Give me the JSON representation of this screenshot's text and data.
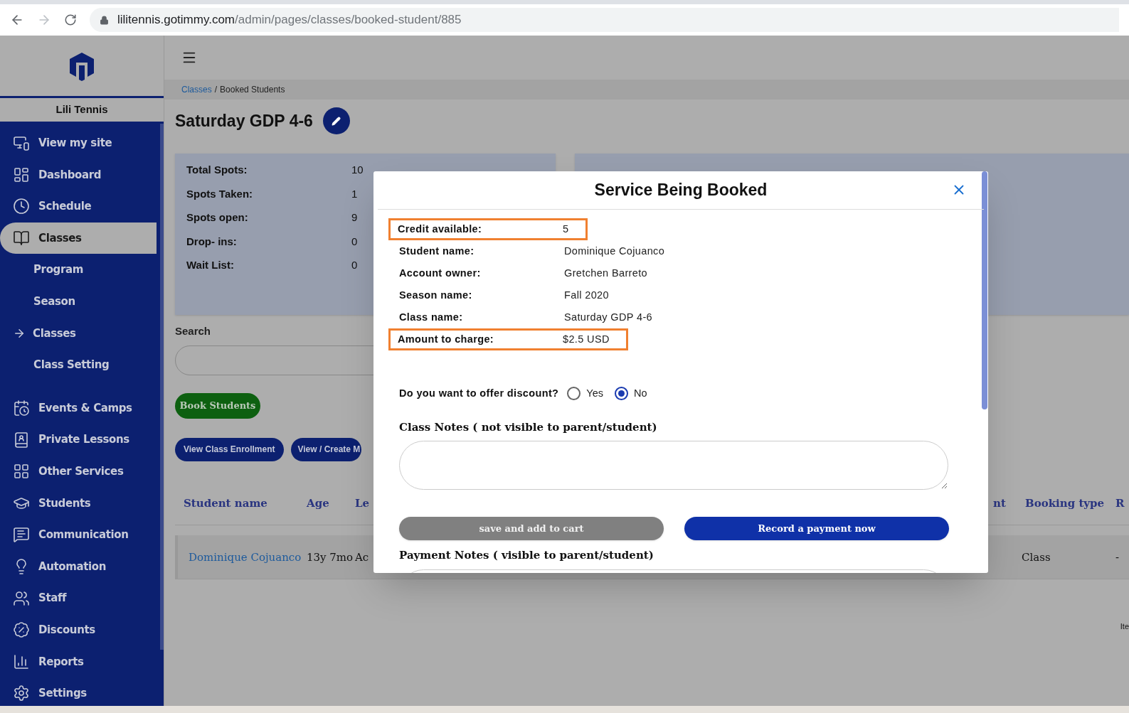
{
  "browser": {
    "url_host": "lilitennis.gotimmy.com",
    "url_path": "/admin/pages/classes/booked-student/885"
  },
  "sidebar": {
    "brand": "Lili Tennis",
    "items": [
      {
        "label": "View my site",
        "kind": "main",
        "selected": false
      },
      {
        "label": "Dashboard",
        "kind": "main",
        "selected": false
      },
      {
        "label": "Schedule",
        "kind": "main",
        "selected": false
      },
      {
        "label": "Classes",
        "kind": "main",
        "selected": true
      },
      {
        "label": "Program",
        "kind": "sub",
        "selected": false
      },
      {
        "label": "Season",
        "kind": "sub",
        "selected": false
      },
      {
        "label": "Classes",
        "kind": "arrow",
        "selected": false
      },
      {
        "label": "Class Setting",
        "kind": "sub",
        "selected": false
      },
      {
        "label": "Events & Camps",
        "kind": "main",
        "selected": false
      },
      {
        "label": "Private Lessons",
        "kind": "main",
        "selected": false
      },
      {
        "label": "Other Services",
        "kind": "main",
        "selected": false
      },
      {
        "label": "Students",
        "kind": "main",
        "selected": false
      },
      {
        "label": "Communication",
        "kind": "main",
        "selected": false
      },
      {
        "label": "Automation",
        "kind": "main",
        "selected": false
      },
      {
        "label": "Staff",
        "kind": "main",
        "selected": false
      },
      {
        "label": "Discounts",
        "kind": "main",
        "selected": false
      },
      {
        "label": "Reports",
        "kind": "main",
        "selected": false
      },
      {
        "label": "Settings",
        "kind": "main",
        "selected": false
      }
    ]
  },
  "breadcrumb": [
    {
      "label": "Classes",
      "kind": "link"
    },
    {
      "label": "/",
      "kind": "separator"
    },
    {
      "label": "Booked Students",
      "kind": "current"
    }
  ],
  "page_title": "Saturday GDP 4-6",
  "stats": [
    {
      "label": "Total Spots:",
      "value": "10"
    },
    {
      "label": "Spots Taken:",
      "value": "1"
    },
    {
      "label": "Spots open:",
      "value": "9"
    },
    {
      "label": "Drop- ins:",
      "value": "0"
    },
    {
      "label": "Wait List:",
      "value": "0"
    }
  ],
  "search": {
    "label": "Search"
  },
  "book_button": "Book Students",
  "view_buttons": [
    "View Class Enrollment",
    "View / Create M"
  ],
  "table": {
    "columns": [
      "Student name",
      "Age",
      "Le",
      "nt",
      "Booking type",
      "R"
    ],
    "rows": [
      {
        "student_name": "Dominique Cojuanco",
        "age": "13y 7mo",
        "column_3": "Ac",
        "booking_type": "Class",
        "column_6": "-"
      }
    ]
  },
  "pagination": "Ite",
  "modal": {
    "title": "Service Being Booked",
    "details": [
      {
        "label": "Credit available:",
        "value": "5",
        "highlighted": true
      },
      {
        "label": "Student name:",
        "value": "Dominique Cojuanco",
        "highlighted": false
      },
      {
        "label": "Account owner:",
        "value": "Gretchen Barreto",
        "highlighted": false
      },
      {
        "label": "Season name:",
        "value": "Fall 2020",
        "highlighted": false
      },
      {
        "label": "Class name:",
        "value": "Saturday GDP 4-6",
        "highlighted": false
      },
      {
        "label": "Amount to charge:",
        "value": "$2.5 USD",
        "highlighted": true
      }
    ],
    "discount": {
      "question": "Do you want to offer discount?",
      "options": [
        {
          "label": "Yes",
          "selected": false
        },
        {
          "label": "No",
          "selected": true
        }
      ]
    },
    "class_notes_label": "Class Notes ( not visible to parent/student)",
    "actions": [
      {
        "label": "save and add to cart",
        "kind": "secondary"
      },
      {
        "label": "Record a payment now",
        "kind": "primary"
      }
    ],
    "payment_notes_label": "Payment Notes ( visible to parent/student)"
  }
}
